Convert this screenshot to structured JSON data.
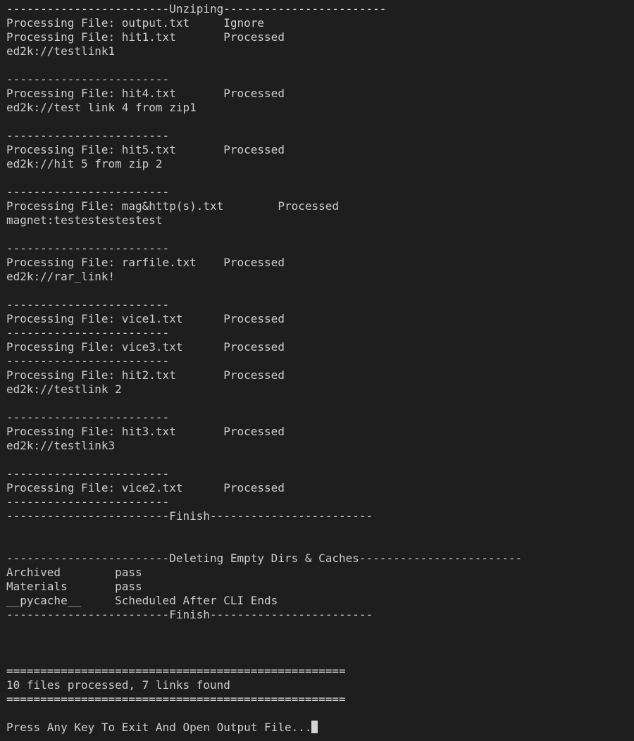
{
  "terminal": {
    "lines": [
      "------------------------Unziping------------------------",
      "Processing File: output.txt     Ignore",
      "Processing File: hit1.txt       Processed",
      "ed2k://testlink1",
      "",
      "------------------------",
      "Processing File: hit4.txt       Processed",
      "ed2k://test link 4 from zip1",
      "",
      "------------------------",
      "Processing File: hit5.txt       Processed",
      "ed2k://hit 5 from zip 2",
      "",
      "------------------------",
      "Processing File: mag&http(s).txt        Processed",
      "magnet:testestestestest",
      "",
      "------------------------",
      "Processing File: rarfile.txt    Processed",
      "ed2k://rar_link!",
      "",
      "------------------------",
      "Processing File: vice1.txt      Processed",
      "------------------------",
      "Processing File: vice3.txt      Processed",
      "------------------------",
      "Processing File: hit2.txt       Processed",
      "ed2k://testlink 2",
      "",
      "------------------------",
      "Processing File: hit3.txt       Processed",
      "ed2k://testlink3",
      "",
      "------------------------",
      "Processing File: vice2.txt      Processed",
      "------------------------",
      "------------------------Finish------------------------",
      "",
      "",
      "------------------------Deleting Empty Dirs & Caches------------------------",
      "Archived        pass",
      "Materials       pass",
      "__pycache__     Scheduled After CLI Ends",
      "------------------------Finish------------------------",
      "",
      "",
      "",
      "==================================================",
      "10 files processed, 7 links found",
      "==================================================",
      "",
      "Press Any Key To Exit And Open Output File..."
    ]
  }
}
